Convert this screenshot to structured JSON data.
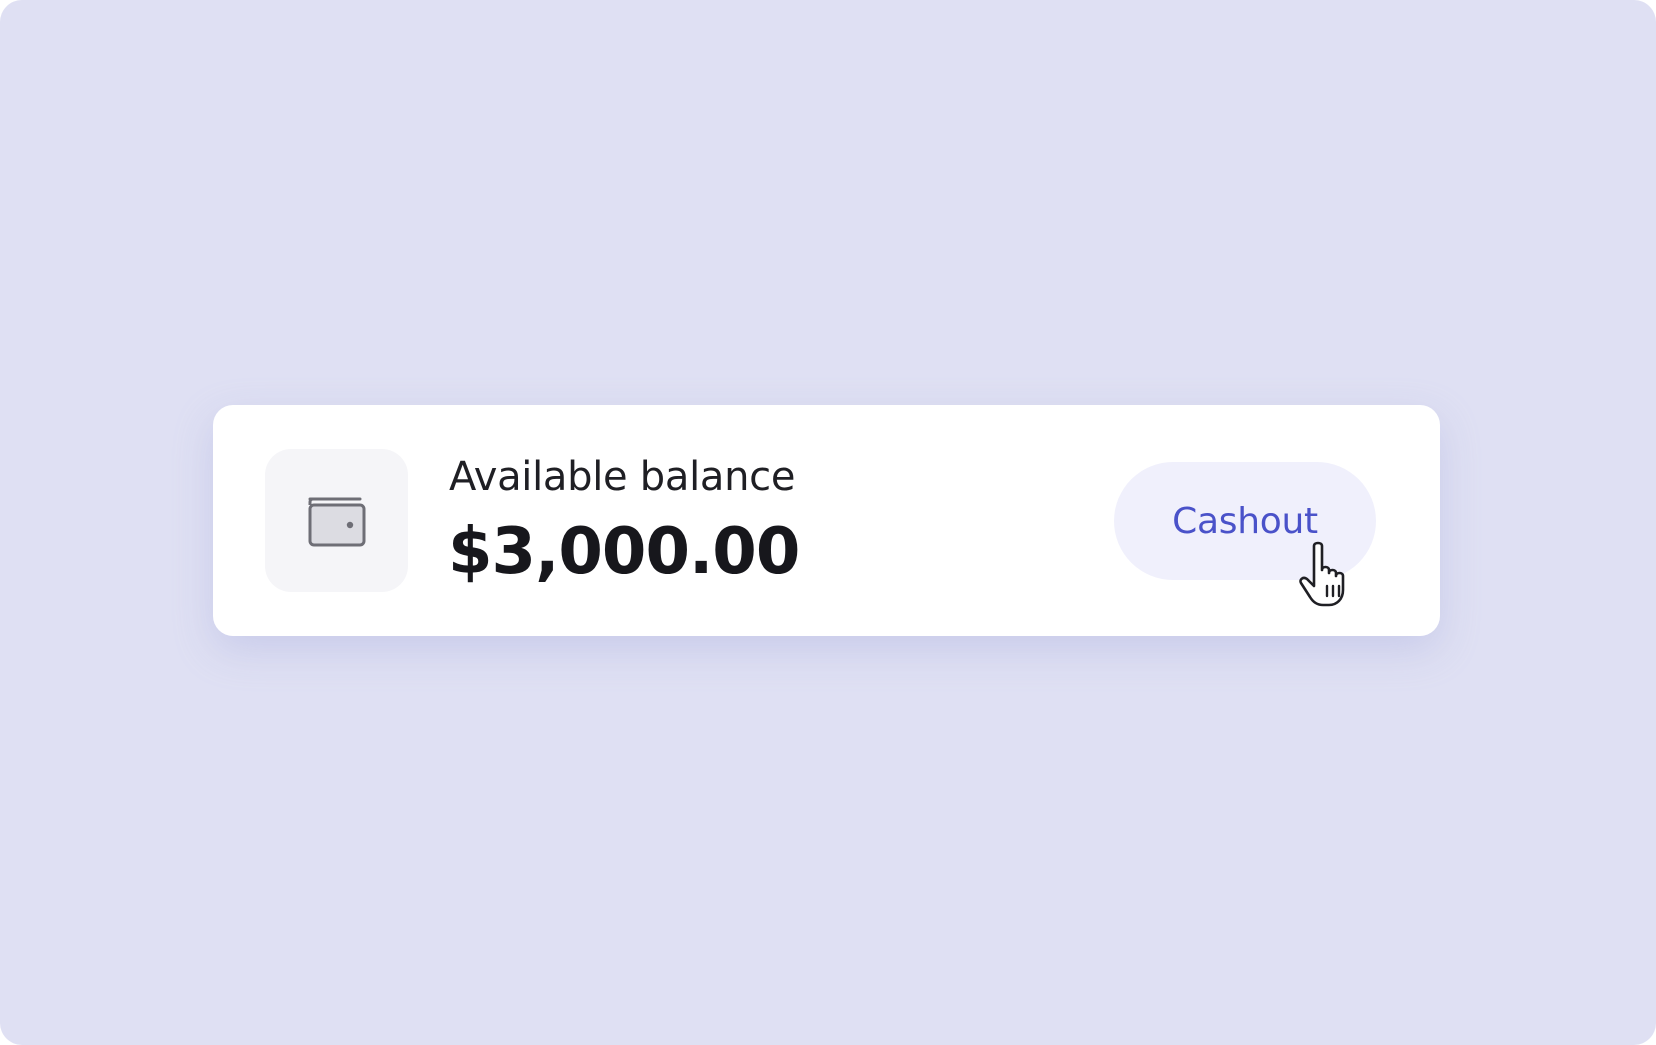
{
  "balance": {
    "label": "Available balance",
    "amount": "$3,000.00",
    "icon": "wallet-icon"
  },
  "actions": {
    "cashout_label": "Cashout",
    "cursor_icon": "hand-pointer-icon"
  },
  "colors": {
    "background": "#dfe0f3",
    "card": "#ffffff",
    "icon_tile": "#f5f5f8",
    "icon_stroke": "#6e6e76",
    "text_primary": "#17171c",
    "button_bg": "#f0f0fc",
    "button_text": "#4a52c9"
  }
}
